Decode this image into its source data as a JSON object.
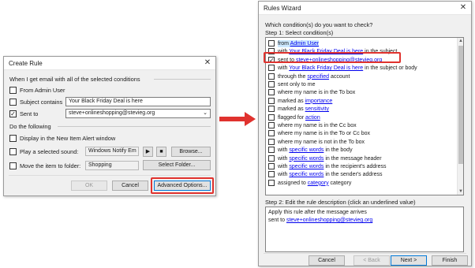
{
  "create_rule": {
    "title": "Create Rule",
    "section_conditions": "When I get email with all of the selected conditions",
    "from_label": "From Admin User",
    "subject_label": "Subject contains",
    "subject_value": "Your Black Friday Deal is here",
    "sent_to_label": "Sent to",
    "sent_to_value": "steve+onlineshopping@stevieg.org",
    "section_actions": "Do the following",
    "display_label": "Display in the New Item Alert window",
    "play_sound_label": "Play a selected sound:",
    "sound_value": "Windows Notify Em",
    "browse_label": "Browse...",
    "move_label": "Move the item to folder:",
    "folder_value": "Shopping",
    "select_folder_label": "Select Folder...",
    "ok_label": "OK",
    "cancel_label": "Cancel",
    "advanced_label": "Advanced Options..."
  },
  "rules_wizard": {
    "title": "Rules Wizard",
    "question": "Which condition(s) do you want to check?",
    "step1": "Step 1: Select condition(s)",
    "conditions": [
      {
        "pre": "from ",
        "link": "Admin User",
        "post": "",
        "checked": false,
        "selected": true
      },
      {
        "pre": "with ",
        "link": "Your Black Friday Deal is here",
        "post": " in the subject",
        "checked": false,
        "selected": false
      },
      {
        "pre": "sent to ",
        "link": "steve+onlineshopping@stevieg.org",
        "post": "",
        "checked": true,
        "selected": false
      },
      {
        "pre": "with ",
        "link": "Your Black Friday Deal is here",
        "post": " in the subject or body",
        "checked": false,
        "selected": false
      },
      {
        "pre": "through the ",
        "link": "specified",
        "post": " account",
        "checked": false,
        "selected": false
      },
      {
        "pre": "sent only to me",
        "link": "",
        "post": "",
        "checked": false,
        "selected": false
      },
      {
        "pre": "where my name is in the To box",
        "link": "",
        "post": "",
        "checked": false,
        "selected": false
      },
      {
        "pre": "marked as ",
        "link": "importance",
        "post": "",
        "checked": false,
        "selected": false
      },
      {
        "pre": "marked as ",
        "link": "sensitivity",
        "post": "",
        "checked": false,
        "selected": false
      },
      {
        "pre": "flagged for ",
        "link": "action",
        "post": "",
        "checked": false,
        "selected": false
      },
      {
        "pre": "where my name is in the Cc box",
        "link": "",
        "post": "",
        "checked": false,
        "selected": false
      },
      {
        "pre": "where my name is in the To or Cc box",
        "link": "",
        "post": "",
        "checked": false,
        "selected": false
      },
      {
        "pre": "where my name is not in the To box",
        "link": "",
        "post": "",
        "checked": false,
        "selected": false
      },
      {
        "pre": "with ",
        "link": "specific words",
        "post": " in the body",
        "checked": false,
        "selected": false
      },
      {
        "pre": "with ",
        "link": "specific words",
        "post": " in the message header",
        "checked": false,
        "selected": false
      },
      {
        "pre": "with ",
        "link": "specific words",
        "post": " in the recipient's address",
        "checked": false,
        "selected": false
      },
      {
        "pre": "with ",
        "link": "specific words",
        "post": " in the sender's address",
        "checked": false,
        "selected": false
      },
      {
        "pre": "assigned to ",
        "link": "category",
        "post": " category",
        "checked": false,
        "selected": false
      }
    ],
    "step2": "Step 2: Edit the rule description (click an underlined value)",
    "desc_line1": "Apply this rule after the message arrives",
    "desc_line2_pre": "sent to ",
    "desc_line2_link": "steve+onlineshopping@stevieg.org",
    "cancel_label": "Cancel",
    "back_label": "< Back",
    "next_label": "Next >",
    "finish_label": "Finish"
  },
  "colors": {
    "highlight": "#e0322e",
    "link": "#0000ee",
    "selection": "#cce8ff",
    "dialog_bg": "#f0f0f0"
  }
}
